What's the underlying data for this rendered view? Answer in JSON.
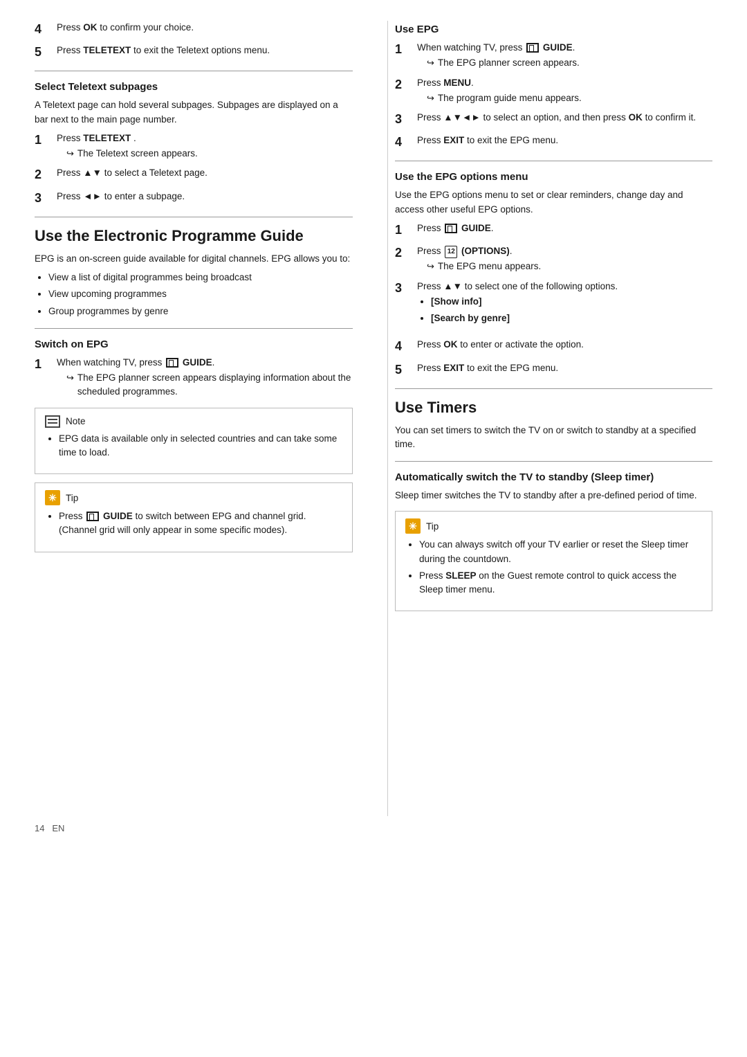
{
  "page": {
    "number": "14",
    "lang": "EN"
  },
  "left": {
    "step4": {
      "text": "Press ",
      "key": "OK",
      "text2": " to confirm your choice."
    },
    "step5": {
      "text": "Press ",
      "key": "TELETEXT",
      "text2": " to exit the Teletext options menu."
    },
    "select_subpages": {
      "title": "Select Teletext subpages",
      "intro": "A Teletext page can hold several subpages. Subpages are displayed on a bar next to the main page number.",
      "steps": [
        {
          "num": "1",
          "text": "Press ",
          "key": "TELETEXT",
          "text2": " .",
          "arrow": "The Teletext screen appears."
        },
        {
          "num": "2",
          "text": "Press ",
          "keys": "▲▼",
          "text2": " to select a Teletext page."
        },
        {
          "num": "3",
          "text": "Press ",
          "keys": "◄►",
          "text2": " to enter a subpage."
        }
      ]
    },
    "epg_section": {
      "title": "Use the Electronic Programme Guide",
      "intro1": "EPG is an on-screen guide available for digital channels. EPG allows you to:",
      "bullets": [
        "View a list of digital programmes being broadcast",
        "View upcoming programmes",
        "Group programmes by genre"
      ]
    },
    "switch_epg": {
      "title": "Switch on EPG",
      "steps": [
        {
          "num": "1",
          "text": "When watching TV, press",
          "icon": "guide",
          "key": "GUIDE",
          "text2": ".",
          "arrow1": "The EPG planner screen appears",
          "arrow2": "displaying information about the",
          "arrow3": "scheduled programmes."
        }
      ]
    },
    "note": {
      "label": "Note",
      "bullets": [
        "EPG data is available only in selected countries and can take some time to load."
      ]
    },
    "tip": {
      "label": "Tip",
      "bullets": [
        "Press  GUIDE to switch between EPG and channel grid. (Channel grid will only appear in some specific modes)."
      ]
    }
  },
  "right": {
    "use_epg": {
      "title": "Use EPG",
      "steps": [
        {
          "num": "1",
          "text": "When watching TV, press",
          "icon": "guide",
          "key": "GUIDE",
          "text2": ".",
          "arrow": "The EPG planner screen appears."
        },
        {
          "num": "2",
          "text": "Press ",
          "key": "MENU",
          "text2": ".",
          "arrow": "The program guide menu appears."
        },
        {
          "num": "3",
          "text": "Press ",
          "keys": "▲▼◄►",
          "text2": " to select an option, and then press ",
          "key2": "OK",
          "text3": " to confirm it."
        },
        {
          "num": "4",
          "text": "Press ",
          "key": "EXIT",
          "text2": " to exit the EPG menu."
        }
      ]
    },
    "epg_options": {
      "title": "Use the EPG options menu",
      "intro": "Use the EPG options menu to set or clear reminders, change day and access other useful EPG options.",
      "steps": [
        {
          "num": "1",
          "text": "Press",
          "icon": "guide",
          "key": "GUIDE",
          "text2": "."
        },
        {
          "num": "2",
          "text": "Press",
          "icon": "options",
          "key": "(OPTIONS)",
          "text2": ".",
          "arrow": "The EPG menu appears."
        },
        {
          "num": "3",
          "text": "Press ",
          "keys": "▲▼",
          "text2": " to select one of the following options.",
          "subbullets": [
            "[Show info]",
            "[Search by genre]"
          ]
        },
        {
          "num": "4",
          "text": "Press ",
          "key": "OK",
          "text2": " to enter or activate the option."
        },
        {
          "num": "5",
          "text": "Press ",
          "key": "EXIT",
          "text2": " to exit the EPG menu."
        }
      ]
    },
    "use_timers": {
      "title": "Use Timers",
      "intro": "You can set timers to switch the TV on or switch to standby at a specified time."
    },
    "auto_standby": {
      "title": "Automatically switch the TV to standby (Sleep timer)",
      "intro": "Sleep timer switches the TV to standby after a pre-defined period of time."
    },
    "tip": {
      "label": "Tip",
      "bullets": [
        "You can always switch off your TV earlier or reset the Sleep timer during the countdown.",
        "Press SLEEP on the Guest remote control to quick access the Sleep timer menu."
      ],
      "sleep_bold": "SLEEP"
    }
  }
}
